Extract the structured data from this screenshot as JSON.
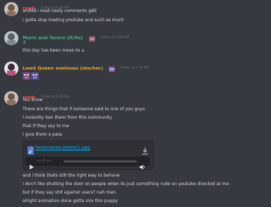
{
  "colors": {
    "background": "#36393f",
    "text": "#dcddde",
    "timestamp": "#72767d",
    "rawb": "#f04747",
    "maris": "#43b581",
    "lewd": "#faa61a",
    "link": "#00b0f4"
  },
  "messages": [
    {
      "author": "rawb",
      "timestamp": "Today at 3:58 AM",
      "lines": [
        "anddd i read nasty comments gdit",
        "i gotta stop loading youtube and such as much"
      ]
    },
    {
      "author": "Maris and Tanice (It/Its)",
      "timestamp": "Today at 3:58 AM",
      "badge_icon": "character-emoji",
      "lines": [
        ":(",
        "this day has been mean to u"
      ]
    },
    {
      "author": "Lewd Queen zoolooau (she/her)",
      "timestamp": "Today at 3:59 AM",
      "badge_icon": "character-emoji",
      "reaction_icons": [
        "character-emoji-1",
        "character-emoji-2"
      ]
    },
    {
      "author": "rawb",
      "timestamp": "Today at 3:59 AM",
      "lines": [
        "You know",
        "There are things that if someone said to one of you guys",
        "I instantly ban them from this community",
        "that if they say to me",
        "I give them a pass"
      ],
      "attachment": {
        "file_name": "herecomes.Jimmy1.ogg",
        "time_display": "-:-- / -:--",
        "icons": [
          "audio-file-icon",
          "download-icon",
          "play-icon",
          "volume-icon"
        ]
      },
      "lines_after": [
        "and i think thats still the right way to behave",
        "i don't like shutting the door on people when its just something rude on youtube directed at me",
        "but if they say shit against users? nah man.",
        "alright animation done gotta mix this puppy"
      ]
    }
  ]
}
